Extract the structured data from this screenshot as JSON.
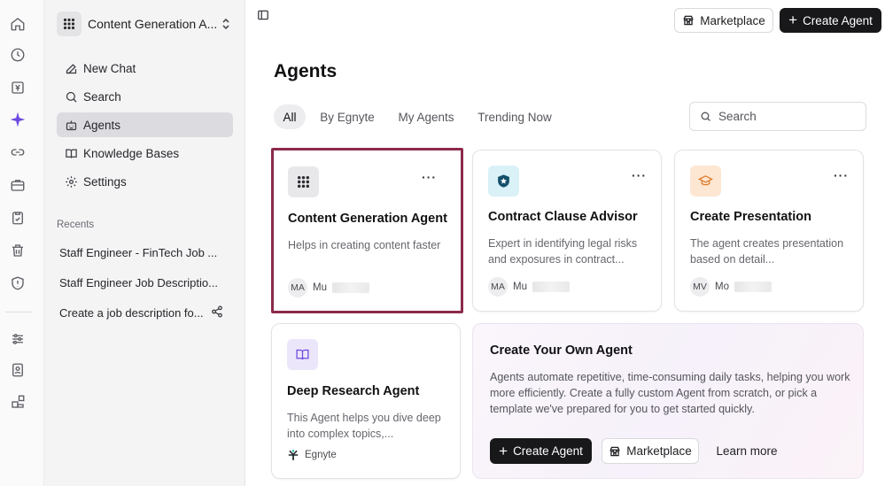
{
  "rail": {
    "icons": [
      "home-icon",
      "history-icon",
      "ledger-icon",
      "sparkle-icon",
      "link-icon",
      "briefcase-icon",
      "clipboard-check-icon",
      "trash-icon",
      "shield-icon",
      "sliders-icon",
      "badge-icon",
      "apps-icon"
    ],
    "accent": "#6d4ae0"
  },
  "sidebar": {
    "workspace_title": "Content Generation A...",
    "nav": [
      {
        "label": "New Chat",
        "icon": "edit-icon"
      },
      {
        "label": "Search",
        "icon": "search-icon"
      },
      {
        "label": "Agents",
        "icon": "robot-icon",
        "active": true
      },
      {
        "label": "Knowledge Bases",
        "icon": "book-icon"
      },
      {
        "label": "Settings",
        "icon": "gear-icon"
      }
    ],
    "recents_label": "Recents",
    "recents": [
      "Staff Engineer - FinTech Job ...",
      "Staff Engineer Job Descriptio...",
      "Create a job description fo..."
    ]
  },
  "header": {
    "marketplace_label": "Marketplace",
    "create_agent_label": "Create Agent"
  },
  "main": {
    "title": "Agents",
    "tabs": [
      "All",
      "By Egnyte",
      "My Agents",
      "Trending Now"
    ],
    "active_tab": "All",
    "search_placeholder": "Search",
    "cards": [
      {
        "title": "Content Generation Agent",
        "description": "Helps in creating content faster",
        "owner_initials": "MA",
        "owner_name": "Mu",
        "icon": "grid-icon",
        "icon_bg": "#e8e8eb",
        "selected": true
      },
      {
        "title": "Contract Clause Advisor",
        "description": "Expert in identifying legal risks and exposures in contract...",
        "owner_initials": "MA",
        "owner_name": "Mu",
        "icon": "shield-star-icon",
        "icon_bg": "#d9f1f7"
      },
      {
        "title": "Create Presentation",
        "description": "The agent creates presentation based on detail...",
        "owner_initials": "MV",
        "owner_name": "Mo",
        "icon": "graduation-cap-icon",
        "icon_bg": "#fde7d3"
      },
      {
        "title": "Deep Research Agent",
        "description": "This Agent helps you dive deep into complex topics,...",
        "owner_name": "Egnyte",
        "icon": "open-book-icon",
        "icon_bg": "#ece6fb"
      }
    ],
    "own_agent": {
      "title": "Create Your Own Agent",
      "description": "Agents automate repetitive, time-consuming daily tasks, helping you work more efficiently. Create a fully custom Agent from scratch, or pick a template we've prepared for you to get started quickly.",
      "create_label": "Create Agent",
      "marketplace_label": "Marketplace",
      "learn_more_label": "Learn more"
    }
  }
}
